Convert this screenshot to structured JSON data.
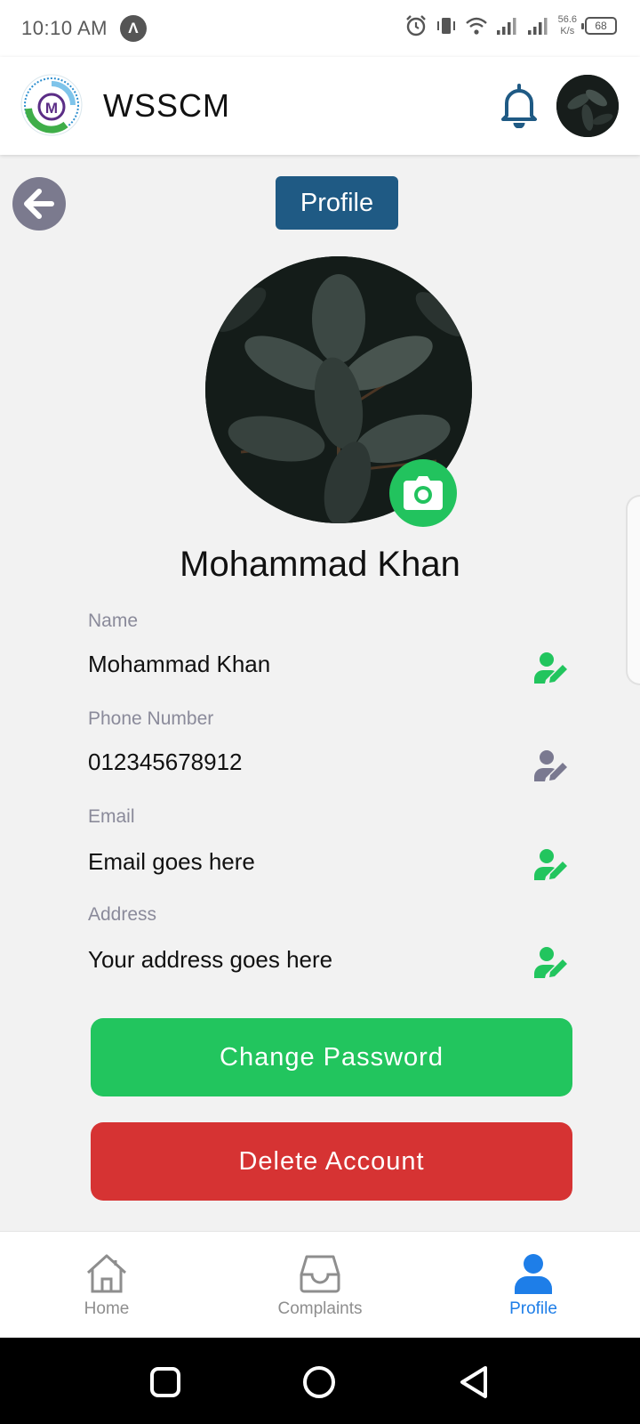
{
  "status_bar": {
    "time": "10:10 AM",
    "net_speed_value": "56.6",
    "net_speed_unit": "K/s",
    "battery": "68"
  },
  "header": {
    "title": "WSSCM",
    "logo_letter": "M"
  },
  "page": {
    "chip_label": "Profile",
    "display_name": "Mohammad Khan"
  },
  "fields": [
    {
      "label": "Name",
      "value": "Mohammad Khan",
      "icon_color": "#22c55e"
    },
    {
      "label": "Phone Number",
      "value": "012345678912",
      "icon_color": "#7a7990"
    },
    {
      "label": "Email",
      "value": "Email goes here",
      "icon_color": "#22c55e"
    },
    {
      "label": "Address",
      "value": "Your address goes here",
      "icon_color": "#22c55e"
    }
  ],
  "actions": {
    "change_password": "Change Password",
    "delete_account": "Delete Account"
  },
  "bottom_nav": [
    {
      "label": "Home",
      "icon": "home-icon",
      "active": false
    },
    {
      "label": "Complaints",
      "icon": "inbox-icon",
      "active": false
    },
    {
      "label": "Profile",
      "icon": "user-icon",
      "active": true
    }
  ],
  "colors": {
    "primary_blue": "#1f5a84",
    "success_green": "#22c55e",
    "danger_red": "#d63333",
    "nav_active": "#1e7ee8"
  }
}
